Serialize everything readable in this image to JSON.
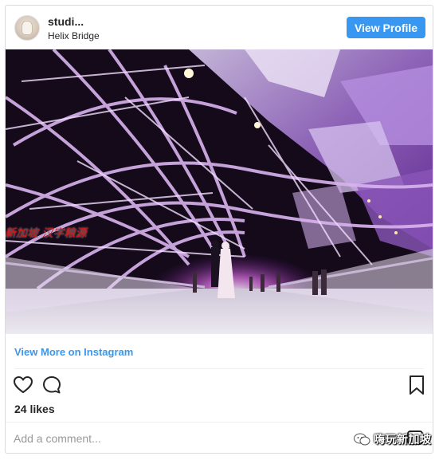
{
  "post": {
    "username": "studi...",
    "location": "Helix Bridge",
    "view_profile_label": "View Profile",
    "photo_caption": "新加坡 汉字粮源",
    "view_more_label": "View More on Instagram",
    "likes_text": "24 likes",
    "comment_placeholder": "Add a comment...",
    "watermark_text": "嗨玩新加坡"
  },
  "colors": {
    "accent": "#3897f0",
    "text": "#262626",
    "border": "#dbdbdb"
  },
  "icons": {
    "like": "heart-icon",
    "comment": "comment-bubble-icon",
    "save": "bookmark-icon",
    "more": "more-options-icon"
  }
}
